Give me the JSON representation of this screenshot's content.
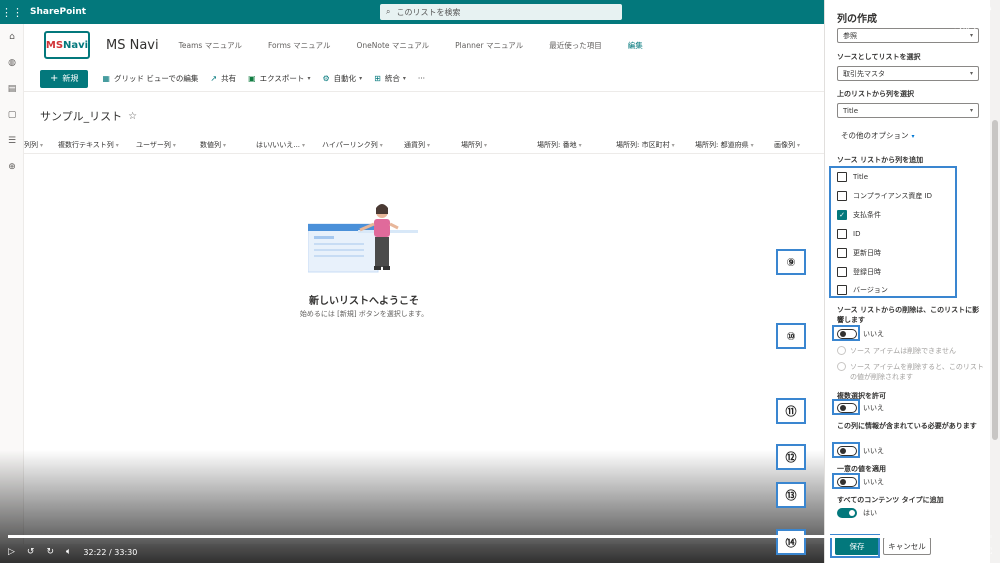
{
  "suite": {
    "app_name": "SharePoint",
    "search_placeholder": "このリストを検索"
  },
  "site": {
    "logo_text_ms": "MS",
    "logo_text_navi": "Navi",
    "title": "MS Navi",
    "nav": [
      "Teams マニュアル",
      "Forms マニュアル",
      "OneNote マニュアル",
      "Planner マニュアル",
      "最近使った項目"
    ],
    "edit_label": "編集"
  },
  "commandbar": {
    "new": "新規",
    "grid_edit": "グリッド ビューでの編集",
    "share": "共有",
    "export": "エクスポート",
    "automate": "自動化",
    "integrate": "統合",
    "more": "···"
  },
  "list": {
    "title": "サンプル_リスト",
    "columns": [
      "列列",
      "複数行テキスト列",
      "ユーザー列",
      "数値列",
      "はい/いいえ...",
      "ハイパーリンク列",
      "通貨列",
      "場所列",
      "場所列: 番地",
      "場所列: 市区町村",
      "場所列: 都道府県",
      "画像列"
    ],
    "welcome_title": "新しいリストへようこそ",
    "welcome_sub": "始めるには [新規] ボタンを選択します。"
  },
  "panel": {
    "title": "列の作成",
    "type_value": "参照",
    "source_list_label": "ソースとしてリストを選択",
    "source_list_value": "取引先マスタ",
    "source_column_label": "上のリストから列を選択",
    "source_column_value": "Title",
    "more_options": "その他のオプション",
    "add_columns_label": "ソース リストから列を追加",
    "checkboxes": [
      {
        "label": "Title",
        "checked": false
      },
      {
        "label": "コンプライアンス資産 ID",
        "checked": false
      },
      {
        "label": "支払条件",
        "checked": true
      },
      {
        "label": "ID",
        "checked": false
      },
      {
        "label": "更新日時",
        "checked": false
      },
      {
        "label": "登録日時",
        "checked": false
      },
      {
        "label": "バージョン",
        "checked": false
      }
    ],
    "delete_affect_label": "ソース リストからの削除は、このリストに影響します",
    "delete_affect_value": "いいえ",
    "radio_1": "ソース アイテムは削除できません",
    "radio_2": "ソース アイテムを削除すると、このリストの値が削除されます",
    "multi_select_label": "複数選択を許可",
    "multi_select_value": "いいえ",
    "required_label": "この列に情報が含まれている必要があります",
    "required_value": "いいえ",
    "unique_label": "一意の値を適用",
    "unique_value": "いいえ",
    "content_types_label": "すべてのコンテンツ タイプに追加",
    "content_types_value": "はい",
    "save": "保存",
    "cancel": "キャンセル"
  },
  "callouts": [
    "⑨",
    "⑩",
    "⑪",
    "⑫",
    "⑬",
    "⑭"
  ],
  "video": {
    "settings": "ビデオの設定",
    "help": "ヘルプ",
    "time": "32:22 / 33:30",
    "progress": 0.966
  }
}
